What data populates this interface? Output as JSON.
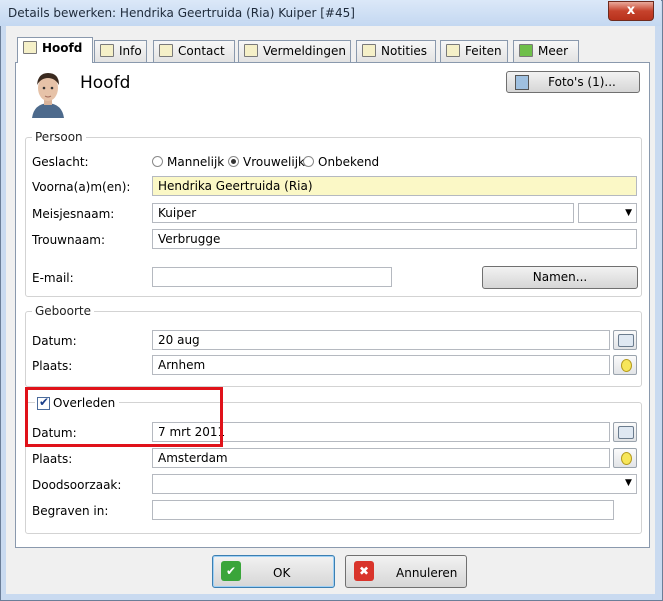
{
  "window": {
    "title": "Details bewerken: Hendrika Geertruida (Ria) Kuiper [#45]",
    "close": "x"
  },
  "tabs": [
    {
      "label": "Hoofd"
    },
    {
      "label": "Info"
    },
    {
      "label": "Contact"
    },
    {
      "label": "Vermeldingen"
    },
    {
      "label": "Notities"
    },
    {
      "label": "Feiten"
    },
    {
      "label": "Meer"
    }
  ],
  "header": {
    "title": "Hoofd",
    "photos_button": "Foto's (1)..."
  },
  "persoon": {
    "group_label": "Persoon",
    "geslacht_label": "Geslacht:",
    "options": [
      "Mannelijk",
      "Vrouwelijk",
      "Onbekend"
    ],
    "selected": "Vrouwelijk",
    "voornamen_label": "Voorna(a)m(en):",
    "voornamen_value": "Hendrika Geertruida (Ria)",
    "meisjesnaam_label": "Meisjesnaam:",
    "meisjesnaam_value": "Kuiper",
    "trouwnaam_label": "Trouwnaam:",
    "trouwnaam_value": "Verbrugge",
    "email_label": "E-mail:",
    "email_value": "",
    "namen_button": "Namen..."
  },
  "geboorte": {
    "group_label": "Geboorte",
    "datum_label": "Datum:",
    "datum_value": "20 aug",
    "plaats_label": "Plaats:",
    "plaats_value": "Arnhem"
  },
  "overleden": {
    "checkbox_label": "Overleden",
    "checked": true,
    "datum_label": "Datum:",
    "datum_value": "7 mrt 2011",
    "plaats_label": "Plaats:",
    "plaats_value": "Amsterdam",
    "doodsoorzaak_label": "Doodsoorzaak:",
    "doodsoorzaak_value": "",
    "begraven_label": "Begraven in:",
    "begraven_value": ""
  },
  "footer": {
    "ok": "OK",
    "cancel": "Annuleren"
  },
  "colors": {
    "highlight_box": "#e0121a",
    "field_highlight": "#fbf8c6"
  }
}
